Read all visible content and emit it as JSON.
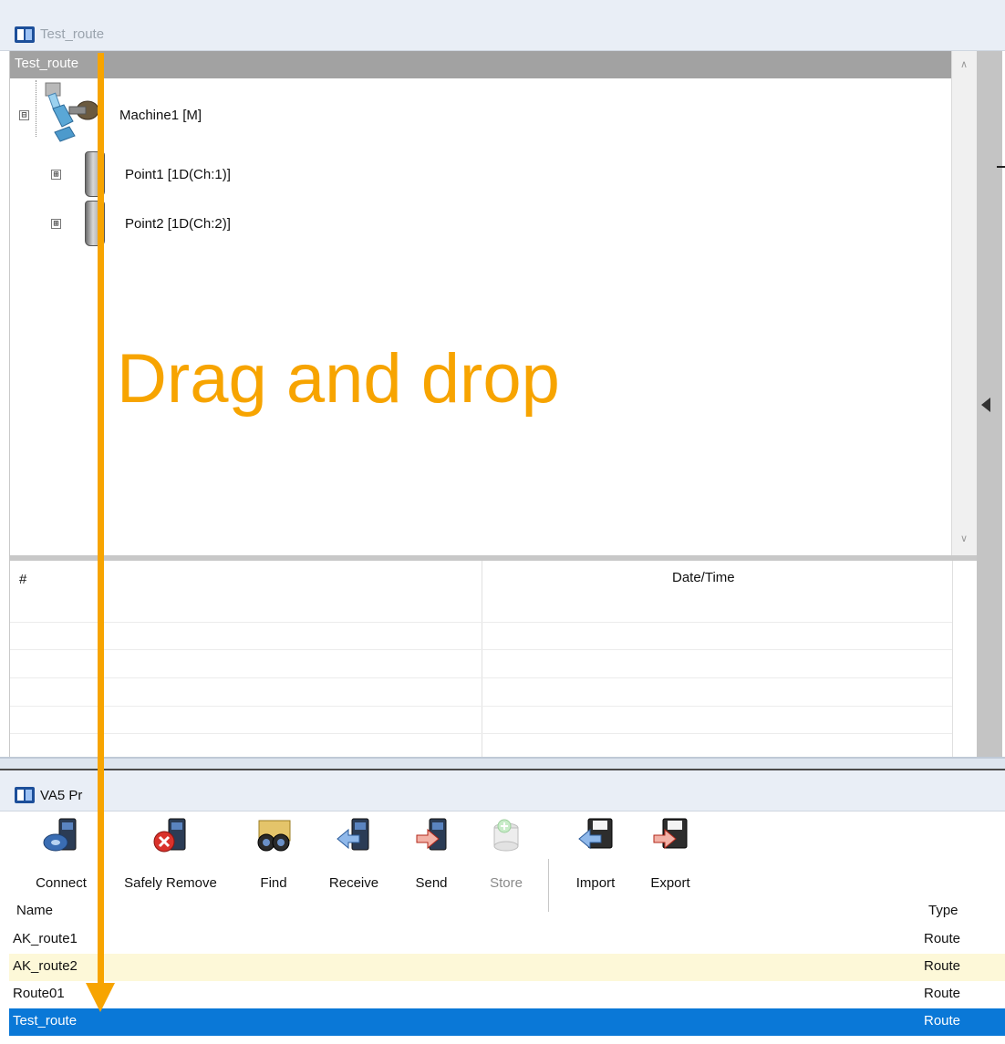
{
  "top_window": {
    "title": "Test_route",
    "tree": {
      "header": "Test_route",
      "nodes": [
        {
          "label": "Machine1 [M]",
          "expander": "⊟"
        },
        {
          "label": "Point1 [1D(Ch:1)]",
          "expander": "⊞"
        },
        {
          "label": "Point2 [1D(Ch:2)]",
          "expander": "⊞"
        }
      ]
    },
    "grid": {
      "columns": [
        "#",
        "Date/Time"
      ]
    }
  },
  "bottom_window": {
    "title": "VA5 Pr",
    "toolbar": {
      "buttons": [
        {
          "label": "Connect",
          "icon": "connect-icon",
          "enabled": true
        },
        {
          "label": "Safely Remove",
          "icon": "safely-remove-icon",
          "enabled": true
        },
        {
          "label": "Find",
          "icon": "binoculars-icon",
          "enabled": true
        },
        {
          "label": "Receive",
          "icon": "receive-icon",
          "enabled": true
        },
        {
          "label": "Send",
          "icon": "send-icon",
          "enabled": true
        },
        {
          "label": "Store",
          "icon": "store-icon",
          "enabled": false
        },
        {
          "label": "Import",
          "icon": "import-icon",
          "enabled": true
        },
        {
          "label": "Export",
          "icon": "export-icon",
          "enabled": true
        }
      ]
    },
    "list": {
      "columns": {
        "name": "Name",
        "type": "Type"
      },
      "rows": [
        {
          "name": "AK_route1",
          "type": "Route",
          "state": "normal"
        },
        {
          "name": "AK_route2",
          "type": "Route",
          "state": "hover"
        },
        {
          "name": "Route01",
          "type": "Route",
          "state": "normal"
        },
        {
          "name": "Test_route",
          "type": "Route",
          "state": "selected"
        }
      ]
    }
  },
  "annotation": {
    "text": "Drag and drop",
    "color": "#f7a400"
  },
  "colors": {
    "selected_row": "#0a78d7",
    "hover_row": "#fdf8d8",
    "tree_header": "#a2a2a2"
  }
}
